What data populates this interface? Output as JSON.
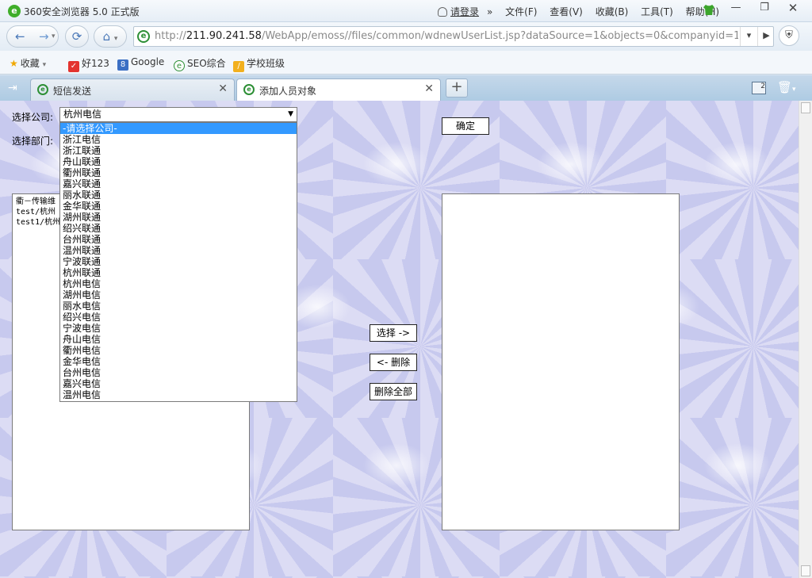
{
  "window": {
    "title": "360安全浏览器 5.0 正式版",
    "login": "请登录",
    "menus": [
      "文件(F)",
      "查看(V)",
      "收藏(B)",
      "工具(T)",
      "帮助(H)"
    ]
  },
  "nav": {
    "url_prefix": "http://",
    "url_host": "211.90.241.58",
    "url_path": "/WebApp/emoss//files/common/wdnewUserList.jsp?dataSource=1&objects=0&companyid=150"
  },
  "bookmarks": [
    {
      "label": "收藏",
      "icon": "star-icon"
    },
    {
      "label": "好123",
      "icon": "hao123-icon"
    },
    {
      "label": "Google",
      "icon": "google-icon"
    },
    {
      "label": "SEO综合",
      "icon": "ie-icon"
    },
    {
      "label": "学校班级",
      "icon": "school-icon"
    }
  ],
  "tabs": [
    {
      "label": "短信发送",
      "active": false
    },
    {
      "label": "添加人员对象",
      "active": true
    }
  ],
  "tab_counter": "2",
  "form": {
    "company_label": "选择公司:",
    "company_value": "杭州电信",
    "department_label": "选择部门:",
    "confirm_button": "确定",
    "company_options": [
      "-请选择公司-",
      "浙江电信",
      "浙江联通",
      "舟山联通",
      "衢州联通",
      "嘉兴联通",
      "丽水联通",
      "金华联通",
      "湖州联通",
      "绍兴联通",
      "台州联通",
      "温州联通",
      "宁波联通",
      "杭州联通",
      "杭州电信",
      "湖州电信",
      "丽水电信",
      "绍兴电信",
      "宁波电信",
      "舟山电信",
      "衢州电信",
      "金华电信",
      "台州电信",
      "嘉兴电信",
      "温州电信"
    ],
    "selected_option_index": 0,
    "left_list": [
      "衢－传输维",
      "test/杭州",
      "test1/杭州"
    ],
    "select_button": "选择 ->",
    "delete_button": "<- 删除",
    "delete_all_button": "删除全部"
  }
}
